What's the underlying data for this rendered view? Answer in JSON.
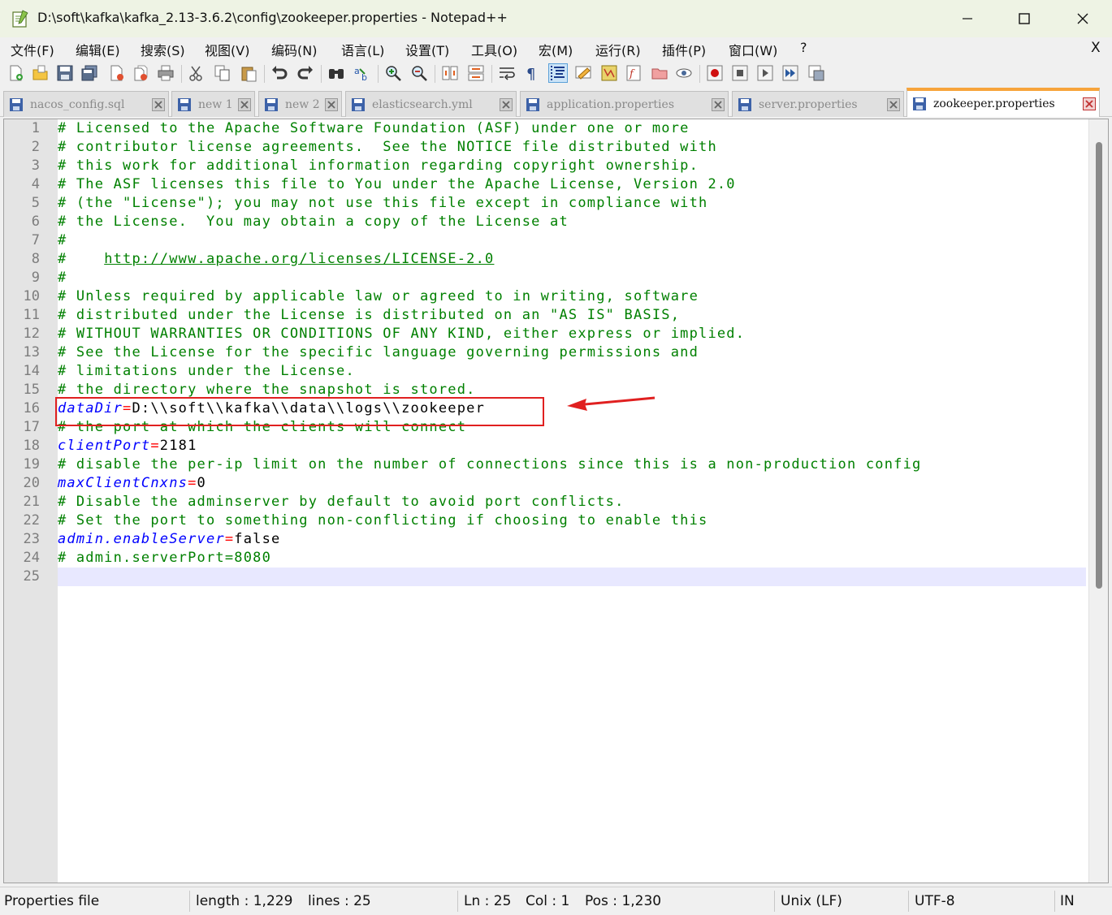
{
  "window": {
    "title": "D:\\soft\\kafka\\kafka_2.13-3.6.2\\config\\zookeeper.properties - Notepad++"
  },
  "menu": {
    "items": [
      "文件(F)",
      "编辑(E)",
      "搜索(S)",
      "视图(V)",
      "编码(N)",
      "语言(L)",
      "设置(T)",
      "工具(O)",
      "宏(M)",
      "运行(R)",
      "插件(P)",
      "窗口(W)",
      "?"
    ],
    "close_label": "X"
  },
  "toolbar": {
    "icons": [
      "new-file-icon",
      "open-file-icon",
      "save-icon",
      "save-all-icon",
      "close-icon",
      "close-all-icon",
      "print-icon",
      "cut-icon",
      "copy-icon",
      "paste-icon",
      "undo-icon",
      "redo-icon",
      "find-icon",
      "replace-icon",
      "zoom-in-icon",
      "zoom-out-icon",
      "sync-vertical-icon",
      "sync-horizontal-icon",
      "word-wrap-icon",
      "show-all-chars-icon",
      "indent-guide-icon",
      "user-language-icon",
      "doc-map-icon",
      "function-list-icon",
      "folder-workspace-icon",
      "monitoring-icon",
      "record-macro-icon",
      "stop-macro-icon",
      "play-macro-icon",
      "run-macro-multiple-icon",
      "save-macro-icon"
    ]
  },
  "tabs": [
    {
      "label": "nacos_config.sql",
      "active": false
    },
    {
      "label": "new 1",
      "active": false
    },
    {
      "label": "new 2",
      "active": false
    },
    {
      "label": "elasticsearch.yml",
      "active": false
    },
    {
      "label": "application.properties",
      "active": false
    },
    {
      "label": "server.properties",
      "active": false
    },
    {
      "label": "zookeeper.properties",
      "active": true
    }
  ],
  "editor": {
    "lines": [
      {
        "n": "1",
        "type": "comment",
        "text": "# Licensed to the Apache Software Foundation (ASF) under one or more"
      },
      {
        "n": "2",
        "type": "comment",
        "text": "# contributor license agreements.  See the NOTICE file distributed with"
      },
      {
        "n": "3",
        "type": "comment",
        "text": "# this work for additional information regarding copyright ownership."
      },
      {
        "n": "4",
        "type": "comment",
        "text": "# The ASF licenses this file to You under the Apache License, Version 2.0"
      },
      {
        "n": "5",
        "type": "comment",
        "text": "# (the \"License\"); you may not use this file except in compliance with"
      },
      {
        "n": "6",
        "type": "comment",
        "text": "# the License.  You may obtain a copy of the License at"
      },
      {
        "n": "7",
        "type": "comment",
        "text": "#"
      },
      {
        "n": "8",
        "type": "url",
        "prefix": "#    ",
        "text": "http://www.apache.org/licenses/LICENSE-2.0"
      },
      {
        "n": "9",
        "type": "comment",
        "text": "#"
      },
      {
        "n": "10",
        "type": "comment",
        "text": "# Unless required by applicable law or agreed to in writing, software"
      },
      {
        "n": "11",
        "type": "comment",
        "text": "# distributed under the License is distributed on an \"AS IS\" BASIS,"
      },
      {
        "n": "12",
        "type": "comment",
        "text": "# WITHOUT WARRANTIES OR CONDITIONS OF ANY KIND, either express or implied."
      },
      {
        "n": "13",
        "type": "comment",
        "text": "# See the License for the specific language governing permissions and"
      },
      {
        "n": "14",
        "type": "comment",
        "text": "# limitations under the License."
      },
      {
        "n": "15",
        "type": "comment",
        "text": "# the directory where the snapshot is stored."
      },
      {
        "n": "16",
        "type": "prop",
        "key": "dataDir",
        "value": "D:\\\\soft\\\\kafka\\\\data\\\\logs\\\\zookeeper"
      },
      {
        "n": "17",
        "type": "comment",
        "text": "# the port at which the clients will connect"
      },
      {
        "n": "18",
        "type": "prop",
        "key": "clientPort",
        "value": "2181"
      },
      {
        "n": "19",
        "type": "comment",
        "text": "# disable the per-ip limit on the number of connections since this is a non-production config"
      },
      {
        "n": "20",
        "type": "prop",
        "key": "maxClientCnxns",
        "value": "0"
      },
      {
        "n": "21",
        "type": "comment",
        "text": "# Disable the adminserver by default to avoid port conflicts."
      },
      {
        "n": "22",
        "type": "comment",
        "text": "# Set the port to something non-conflicting if choosing to enable this"
      },
      {
        "n": "23",
        "type": "prop",
        "key": "admin.enableServer",
        "value": "false"
      },
      {
        "n": "24",
        "type": "comment",
        "text": "# admin.serverPort=8080"
      },
      {
        "n": "25",
        "type": "empty",
        "text": ""
      }
    ],
    "current_line": 25
  },
  "status": {
    "file_type": "Properties file",
    "length": "length : 1,229",
    "lines": "lines : 25",
    "ln": "Ln : 25",
    "col": "Col : 1",
    "pos": "Pos : 1,230",
    "eol": "Unix (LF)",
    "encoding": "UTF-8",
    "mode": "IN"
  },
  "colors": {
    "comment": "#008000",
    "key": "#0000ff",
    "operator": "#ff0000",
    "annotation": "#e02020",
    "active_tab_accent": "#f7a43b"
  }
}
